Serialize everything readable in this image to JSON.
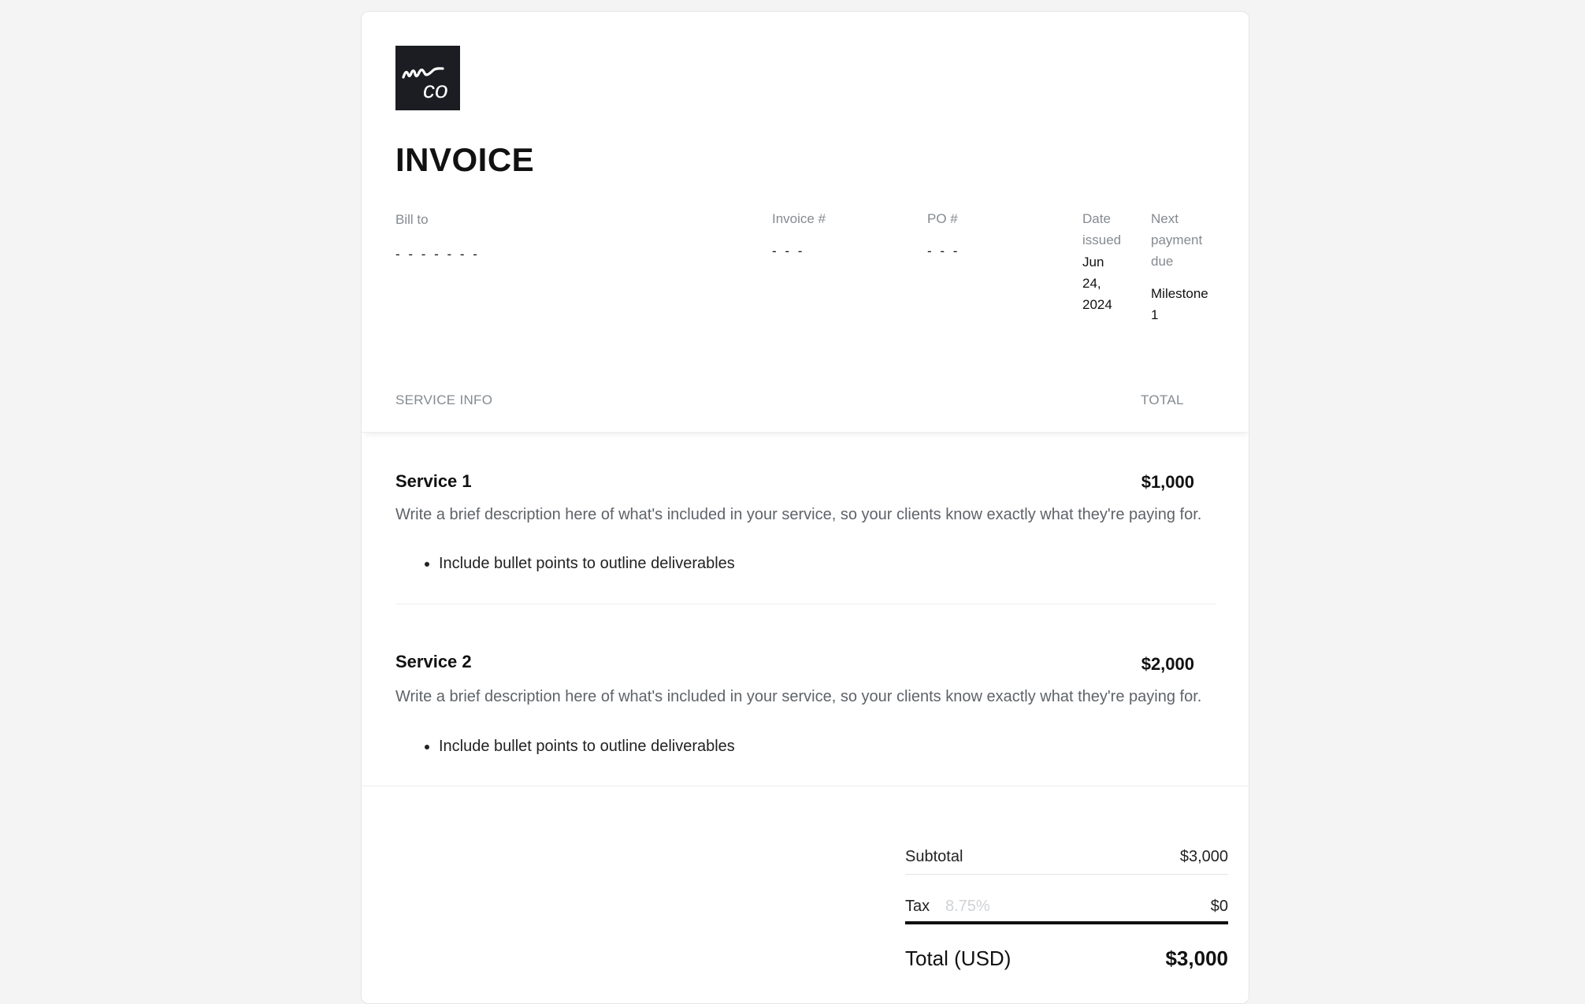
{
  "logo": {
    "text": "mco",
    "colors": {
      "background": "#1c1d22",
      "foreground": "#ffffff"
    }
  },
  "title": "INVOICE",
  "bill_to": {
    "label": "Bill to",
    "value": "- - - - - - -"
  },
  "invoice_number": {
    "label": "Invoice #",
    "value": "- - -"
  },
  "po_number": {
    "label": "PO #",
    "value": "- - -"
  },
  "date_issued": {
    "label_lines": [
      "Date",
      "issued"
    ],
    "value_lines": [
      "Jun",
      "24,",
      "2024"
    ]
  },
  "next_payment": {
    "label_lines": [
      "Next",
      "payment",
      "due"
    ],
    "value_lines": [
      "Milestone",
      "1"
    ]
  },
  "table": {
    "headers": {
      "service": "SERVICE INFO",
      "total": "TOTAL"
    }
  },
  "services": [
    {
      "name": "Service 1",
      "price": "$1,000",
      "description": "Write a brief description here of what's included in your service, so your clients know exactly what they're paying for.",
      "bullets": [
        "Include bullet points to outline deliverables"
      ]
    },
    {
      "name": "Service 2",
      "price": "$2,000",
      "description": "Write a brief description here of what's included in your service, so your clients know exactly what they're paying for.",
      "bullets": [
        "Include bullet points to outline deliverables"
      ]
    }
  ],
  "summary": {
    "subtotal_label": "Subtotal",
    "subtotal_value": "$3,000",
    "tax_label": "Tax",
    "tax_rate": "8.75%",
    "tax_value": "$0",
    "total_label": "Total (USD)",
    "total_value": "$3,000"
  }
}
